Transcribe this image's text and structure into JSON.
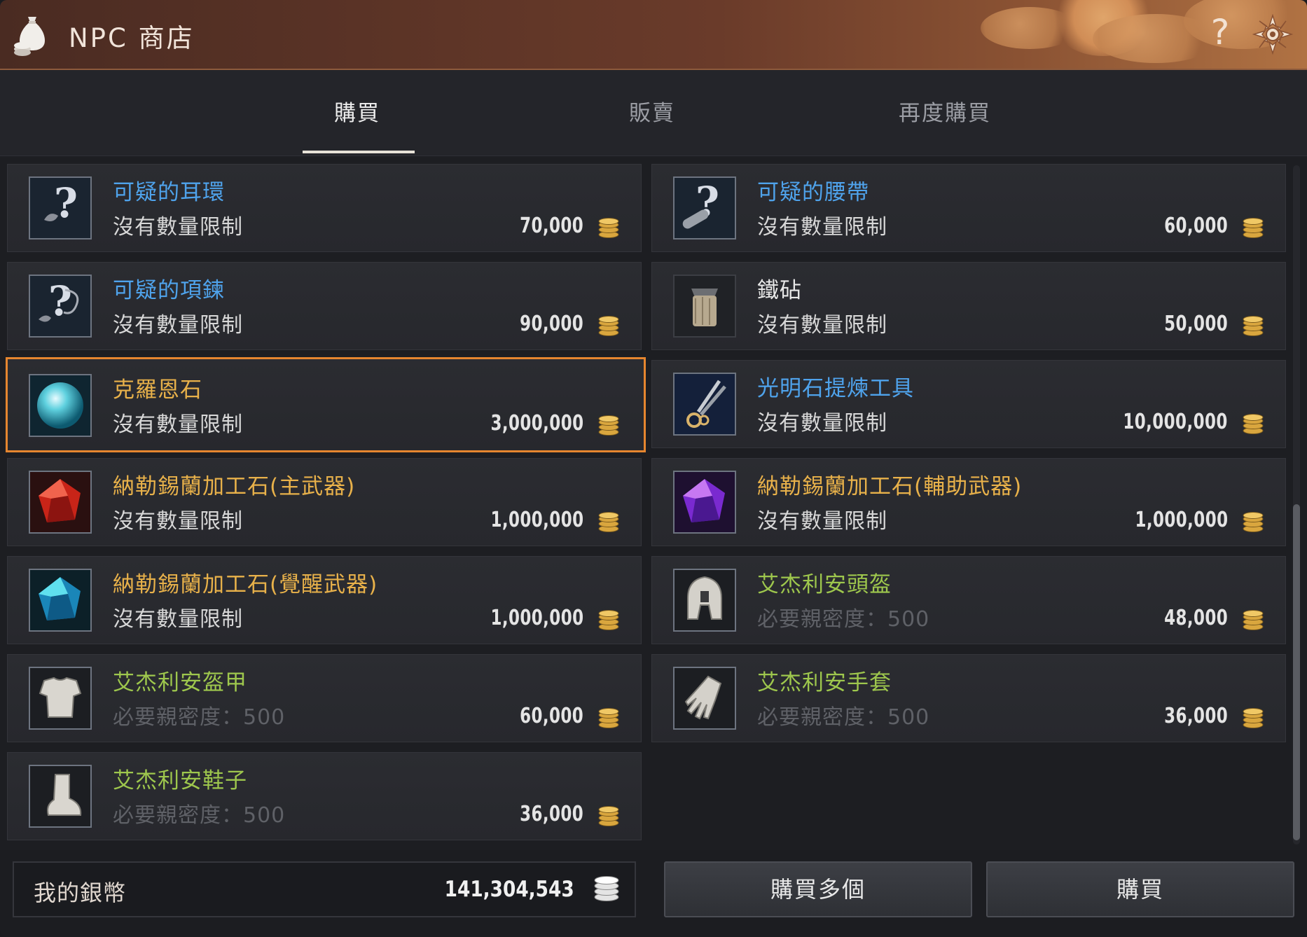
{
  "window": {
    "title": "NPC 商店",
    "help_label": "?"
  },
  "tabs": [
    {
      "label": "購買",
      "active": true
    },
    {
      "label": "販賣",
      "active": false
    },
    {
      "label": "再度購買",
      "active": false
    }
  ],
  "items": [
    {
      "name": "可疑的耳環",
      "limit": "沒有數量限制",
      "price": "70,000",
      "name_color": "blue",
      "icon": "mystery-earring-icon"
    },
    {
      "name": "可疑的腰帶",
      "limit": "沒有數量限制",
      "price": "60,000",
      "name_color": "blue",
      "icon": "mystery-belt-icon"
    },
    {
      "name": "可疑的項鍊",
      "limit": "沒有數量限制",
      "price": "90,000",
      "name_color": "blue",
      "icon": "mystery-necklace-icon"
    },
    {
      "name": "鐵砧",
      "limit": "沒有數量限制",
      "price": "50,000",
      "name_color": "white",
      "icon": "anvil-icon"
    },
    {
      "name": "克羅恩石",
      "limit": "沒有數量限制",
      "price": "3,000,000",
      "name_color": "gold",
      "icon": "cron-stone-icon",
      "selected": true
    },
    {
      "name": "光明石提煉工具",
      "limit": "沒有數量限制",
      "price": "10,000,000",
      "name_color": "blue",
      "icon": "extraction-tool-icon"
    },
    {
      "name": "納勒錫蘭加工石(主武器)",
      "limit": "沒有數量限制",
      "price": "1,000,000",
      "name_color": "gold",
      "icon": "red-gem-icon"
    },
    {
      "name": "納勒錫蘭加工石(輔助武器)",
      "limit": "沒有數量限制",
      "price": "1,000,000",
      "name_color": "gold",
      "icon": "purple-gem-icon"
    },
    {
      "name": "納勒錫蘭加工石(覺醒武器)",
      "limit": "沒有數量限制",
      "price": "1,000,000",
      "name_color": "gold",
      "icon": "blue-gem-icon"
    },
    {
      "name": "艾杰利安頭盔",
      "limit": "必要親密度：500",
      "price": "48,000",
      "name_color": "green",
      "icon": "helmet-icon",
      "dim_limit": true
    },
    {
      "name": "艾杰利安盔甲",
      "limit": "必要親密度：500",
      "price": "60,000",
      "name_color": "green",
      "icon": "armor-icon",
      "dim_limit": true
    },
    {
      "name": "艾杰利安手套",
      "limit": "必要親密度：500",
      "price": "36,000",
      "name_color": "green",
      "icon": "gloves-icon",
      "dim_limit": true
    },
    {
      "name": "艾杰利安鞋子",
      "limit": "必要親密度：500",
      "price": "36,000",
      "name_color": "green",
      "icon": "shoes-icon",
      "dim_limit": true
    }
  ],
  "footer": {
    "wallet_label": "我的銀幣",
    "wallet_amount": "141,304,543",
    "buy_multiple_label": "購買多個",
    "buy_label": "購買"
  },
  "colors": {
    "blue": "#4fa3ec",
    "white": "#e8e8e8",
    "gold": "#e8b14a",
    "green": "#9ec74d",
    "selection": "#e6862f"
  }
}
